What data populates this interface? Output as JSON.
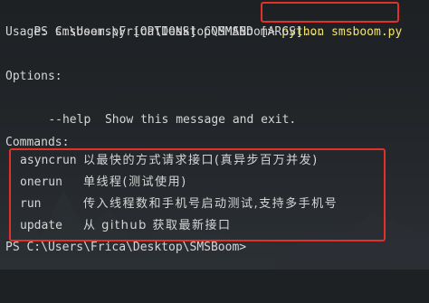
{
  "prompt": {
    "path_prompt": "PS C:\\Users\\Frica\\Desktop\\SMSBoom>",
    "command": "python smsboom.py"
  },
  "usage": "Usage: smsboom.py [OPTIONS] COMMAND [ARGS]...",
  "options": {
    "heading": "Options:",
    "items": [
      {
        "flag": "--help",
        "desc": "Show this message and exit."
      }
    ]
  },
  "commands": {
    "heading": "Commands:",
    "items": [
      {
        "name": "asyncrun",
        "desc": "以最快的方式请求接口(真异步百万并发)"
      },
      {
        "name": "onerun",
        "desc": "单线程(测试使用)"
      },
      {
        "name": "run",
        "desc": "传入线程数和手机号启动测试,支持多手机号"
      },
      {
        "name": "update",
        "desc": "从 github 获取最新接口"
      }
    ]
  },
  "final_prompt": "PS C:\\Users\\Frica\\Desktop\\SMSBoom>",
  "colors": {
    "background": "#1e2124",
    "text": "#d6d6d6",
    "highlight_border": "#e0322b",
    "command_text": "#f2e36b"
  }
}
